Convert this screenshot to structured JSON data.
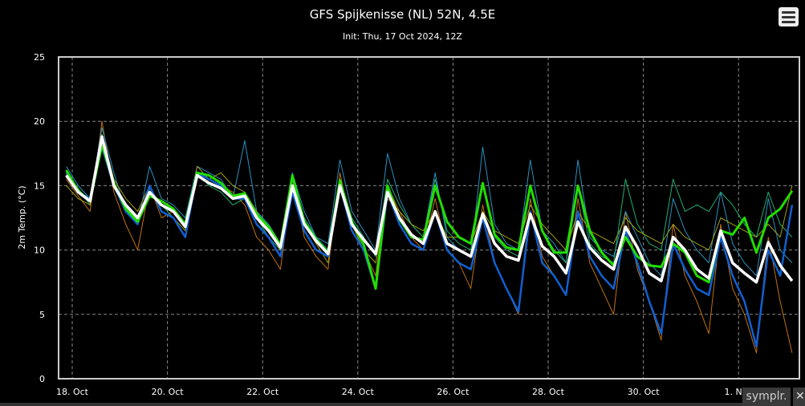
{
  "chart_data": {
    "type": "line",
    "title": "GFS Spijkenisse (NL) 52N, 4.5E",
    "subtitle": "Init: Thu, 17 Oct 2024, 12Z",
    "ylabel": "2m Temp. (°C)",
    "ylim": [
      0,
      25
    ],
    "yticks": [
      "0",
      "5",
      "10",
      "15",
      "20",
      "25"
    ],
    "xticks": [
      "18. Oct",
      "20. Oct",
      "22. Oct",
      "24. Oct",
      "26. Oct",
      "28. Oct",
      "30. Oct",
      "1. Nov"
    ],
    "grid": true,
    "x": [
      "17T21",
      "18T03",
      "18T09",
      "18T15",
      "18T21",
      "19T03",
      "19T09",
      "19T15",
      "19T21",
      "20T03",
      "20T09",
      "20T15",
      "20T21",
      "21T03",
      "21T09",
      "21T15",
      "21T21",
      "22T03",
      "22T09",
      "22T15",
      "22T21",
      "23T03",
      "23T09",
      "23T15",
      "23T21",
      "24T03",
      "24T09",
      "24T15",
      "24T21",
      "25T03",
      "25T09",
      "25T15",
      "25T21",
      "26T03",
      "26T09",
      "26T15",
      "26T21",
      "27T03",
      "27T09",
      "27T15",
      "27T21",
      "28T03",
      "28T09",
      "28T15",
      "28T21",
      "29T03",
      "29T09",
      "29T15",
      "29T21",
      "30T03",
      "30T09",
      "30T15",
      "30T21",
      "31T03",
      "31T09",
      "31T15",
      "31T21",
      "01T03",
      "01T09",
      "01T15",
      "01T21",
      "02T03"
    ],
    "series": [
      {
        "role": "member",
        "color": "#c07010",
        "values": [
          15.5,
          14.2,
          13,
          20,
          14.5,
          12,
          10,
          15,
          12.5,
          13,
          12,
          16,
          15.5,
          15,
          14.5,
          13.5,
          11,
          10,
          8.5,
          15.5,
          11,
          9.5,
          8.5,
          16,
          11.5,
          10,
          8,
          15,
          13,
          11,
          10,
          14,
          10,
          9,
          7,
          13.5,
          9,
          7,
          5,
          14,
          9.5,
          8,
          6.5,
          14,
          9,
          7,
          5,
          13,
          8.5,
          6,
          3,
          12,
          8,
          6,
          3.5,
          12,
          7,
          5,
          2,
          11,
          6,
          2
        ]
      },
      {
        "role": "member",
        "color": "#2a90c0",
        "values": [
          16.5,
          15,
          14,
          19.5,
          16,
          13,
          12,
          16.5,
          14,
          13.5,
          12.5,
          16.5,
          16,
          15.5,
          14,
          18.5,
          13,
          12,
          10.5,
          16,
          13,
          11,
          10.5,
          17,
          13,
          11.5,
          10,
          17.5,
          14,
          12,
          11,
          16,
          11,
          10,
          9.5,
          18,
          12,
          10.5,
          10,
          17,
          11.5,
          10.5,
          9,
          17,
          11,
          10,
          9.5,
          13,
          11,
          9,
          8,
          14,
          11.5,
          10,
          9,
          14.5,
          10.5,
          9,
          8,
          14,
          10,
          9
        ]
      },
      {
        "role": "member",
        "color": "#20b070",
        "values": [
          16,
          14.8,
          13.5,
          18.5,
          15.2,
          13,
          12,
          14.8,
          13.5,
          12.5,
          11,
          16,
          15,
          14.5,
          13.5,
          14,
          12.5,
          11,
          10,
          15.5,
          12.5,
          11,
          10,
          15.5,
          12.5,
          11,
          9.5,
          15.5,
          13.5,
          12,
          11,
          15.5,
          11.5,
          10.5,
          10,
          15,
          11,
          10,
          9.5,
          15,
          11.5,
          10,
          9,
          15,
          10.5,
          9.5,
          9,
          15.5,
          12,
          10.5,
          10,
          15.5,
          13,
          13.5,
          13,
          14.5,
          13.5,
          12,
          11,
          14.5,
          12,
          11
        ]
      },
      {
        "role": "member",
        "color": "#a0a010",
        "values": [
          15,
          14,
          13.5,
          19,
          15.5,
          14,
          13,
          15,
          13,
          12.5,
          11.5,
          16.5,
          15.5,
          16,
          15,
          14.5,
          13,
          11.5,
          10,
          15,
          12,
          10.5,
          9,
          15.5,
          12,
          10,
          9,
          14,
          13,
          12,
          11.5,
          13,
          11,
          11,
          10.5,
          13,
          11.5,
          11,
          10.5,
          13.5,
          12,
          11,
          10,
          13,
          11.5,
          11,
          10.5,
          12.5,
          11.5,
          11,
          10.5,
          12,
          11,
          10.5,
          10,
          12.5,
          12,
          11.5,
          11,
          12,
          11,
          15
        ]
      },
      {
        "role": "member",
        "color": "#1060d0",
        "values": [
          16,
          14.5,
          14,
          18,
          15,
          13,
          12,
          15,
          13,
          12.5,
          11,
          16,
          15.5,
          15,
          14,
          14,
          12,
          11,
          9.5,
          14.5,
          11.5,
          10,
          9.5,
          15,
          11.5,
          10,
          7,
          14.5,
          12,
          10.5,
          10,
          13,
          10,
          9,
          8.5,
          12.5,
          9,
          7,
          5.2,
          13,
          9,
          8,
          6.5,
          13,
          9.5,
          8,
          7,
          11.5,
          9,
          6,
          3.5,
          10.5,
          8.5,
          7,
          6.5,
          11,
          8,
          6,
          2.5,
          10,
          8,
          13.5
        ]
      },
      {
        "role": "control",
        "color": "#22dd00",
        "values": [
          16.2,
          14.6,
          13.8,
          18.2,
          15.2,
          13.2,
          12.2,
          14.2,
          13.8,
          13.2,
          12,
          16,
          15.8,
          15.2,
          14.2,
          14.4,
          12.8,
          11.8,
          10.4,
          15.8,
          12.2,
          10.8,
          9.8,
          15.4,
          12.2,
          10.4,
          7,
          15,
          12.4,
          11,
          10.8,
          15,
          12.2,
          11,
          10.5,
          15.2,
          11.2,
          10.2,
          10,
          15,
          11.5,
          9.8,
          9.8,
          15,
          11.5,
          9.8,
          8.8,
          11,
          9.5,
          8.8,
          8.7,
          10.5,
          9.8,
          8,
          7.5,
          11.5,
          11.2,
          12.5,
          9.8,
          12.5,
          13.2,
          14.6
        ]
      },
      {
        "role": "mean",
        "color": "#ffffff",
        "values": [
          15.8,
          14.5,
          13.8,
          18.8,
          15,
          13.5,
          12.5,
          14.5,
          13.5,
          13,
          11.8,
          15.8,
          15.2,
          14.8,
          14,
          14.2,
          12.5,
          11.5,
          10.2,
          15,
          12,
          10.7,
          9.7,
          15,
          12,
          10.8,
          9.7,
          14.5,
          12.5,
          11.2,
          10.5,
          13,
          10.5,
          10,
          9.5,
          12.8,
          10.5,
          9.5,
          9.2,
          12.8,
          10.3,
          9.5,
          8.2,
          12.2,
          10.2,
          9.2,
          8.5,
          11.8,
          10.2,
          8.2,
          7.6,
          11,
          10,
          8.5,
          7.8,
          11.5,
          9,
          8.2,
          7.5,
          10.6,
          8.8,
          7.6
        ]
      }
    ]
  },
  "ui": {
    "badge_label": "symplr.",
    "close_label": "✕",
    "menu_icon": "hamburger-menu-icon"
  }
}
